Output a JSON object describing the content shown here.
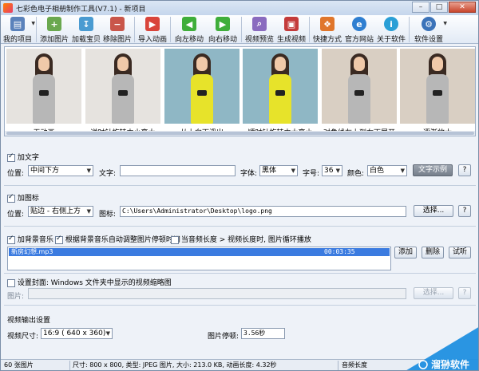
{
  "title": "七彩色电子相册制作工具(V7.1) - 新项目",
  "toolbar": [
    {
      "label": "我的项目",
      "icon": "folder-icon"
    },
    {
      "label": "添加图片",
      "icon": "add-image-icon"
    },
    {
      "label": "加载宝贝",
      "icon": "load-item-icon"
    },
    {
      "label": "移除图片",
      "icon": "remove-image-icon"
    },
    {
      "label": "导入动画",
      "icon": "import-animation-icon"
    },
    {
      "label": "向左移动",
      "icon": "arrow-left-icon"
    },
    {
      "label": "向右移动",
      "icon": "arrow-right-icon"
    },
    {
      "label": "视频预览",
      "icon": "magnifier-icon"
    },
    {
      "label": "生成视频",
      "icon": "generate-video-icon"
    },
    {
      "label": "快捷方式",
      "icon": "shortcut-cubes-icon"
    },
    {
      "label": "官方网站",
      "icon": "ie-globe-icon"
    },
    {
      "label": "关于软件",
      "icon": "about-info-icon"
    },
    {
      "label": "软件设置",
      "icon": "gear-icon"
    }
  ],
  "gallery": {
    "items": [
      {
        "caption": "无动画",
        "outfit": "#b7b7b7"
      },
      {
        "caption": "逆时针旋转由小变大",
        "outfit": "#b7b7b7"
      },
      {
        "caption": "从上向下滑出",
        "outfit": "#e7e32a"
      },
      {
        "caption": "顺时针旋转由大变小",
        "outfit": "#e7e32a"
      },
      {
        "caption": "对角线左上到右下展开",
        "outfit": "#b7b7b7"
      },
      {
        "caption": "逐渐放大",
        "outfit": "#b7b7b7"
      }
    ]
  },
  "text_section": {
    "checkbox_label": "加文字",
    "checked": true,
    "position_label": "位置:",
    "position_value": "中间下方",
    "text_label": "文字:",
    "text_value": "",
    "font_label": "字体:",
    "font_value": "黑体",
    "size_label": "字号:",
    "size_value": "36",
    "color_label": "颜色:",
    "color_value": "白色",
    "sample_button": "文字示例",
    "help_button": "?"
  },
  "icon_section": {
    "checkbox_label": "加图标",
    "checked": true,
    "position_label": "位置:",
    "position_value": "贴边 - 右侧上方",
    "icon_label": "图标:",
    "icon_path": "C:\\Users\\Administrator\\Desktop\\logo.png",
    "choose_button": "选择...",
    "help_button": "?"
  },
  "music_section": {
    "bg_music_label": "加背景音乐",
    "bg_music_checked": true,
    "auto_adjust_label": "根据背景音乐自动调整图片停顿时间",
    "auto_adjust_checked": true,
    "loop_label": "当音频长度 > 视频长度时, 图片循环播放",
    "loop_checked": false,
    "track_name": "新房幻想.mp3",
    "track_duration": "00:03:35",
    "add_button": "添加",
    "delete_button": "删除",
    "listen_button": "试听"
  },
  "cover_section": {
    "checkbox_label": "设置封面: Windows 文件夹中显示的视频缩略图",
    "checked": false,
    "image_label": "图片:",
    "choose_button": "选择...",
    "help_button": "?"
  },
  "output_section": {
    "heading": "视频输出设置",
    "size_label": "视频尺寸:",
    "size_value": "16:9 ( 640 x  360)",
    "pause_label": "图片停顿:",
    "pause_value": "3.56秒"
  },
  "statusbar": {
    "count": "60 张图片",
    "info": "尺寸: 800 x 800, 类型: JPEG 图片, 大小: 213.0 KB, 动画长度: 4.32秒",
    "audio": "音频长度"
  },
  "watermark": {
    "text": "溜狲软件"
  },
  "window_controls": {
    "minimize": "–",
    "maximize": "□",
    "close": "✕"
  }
}
